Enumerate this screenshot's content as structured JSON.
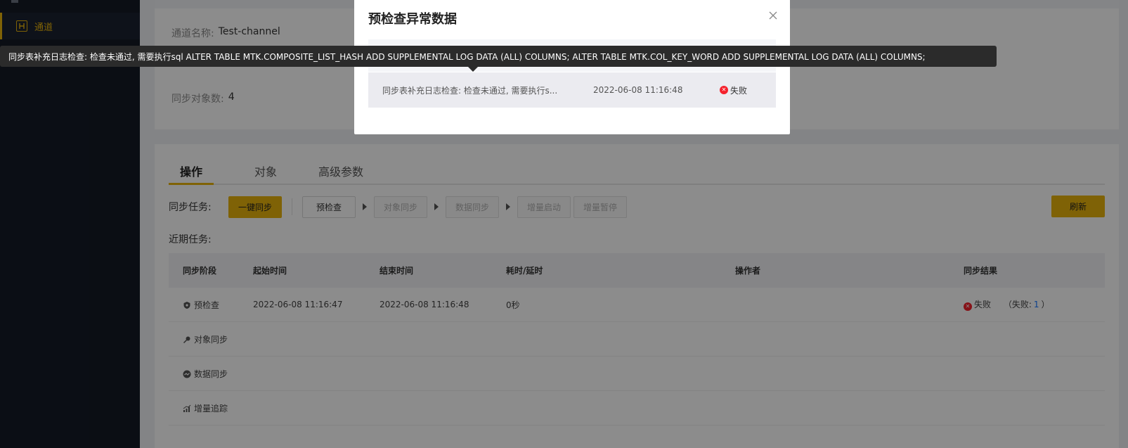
{
  "sidebar": {
    "items": [
      {
        "label": "通道",
        "icon": "channel-icon",
        "active": true
      }
    ],
    "accent": "#e7b30b"
  },
  "info": {
    "channel_name_label": "通道名称:",
    "channel_name_value": "Test-channel",
    "sync_count_label": "同步对象数:",
    "sync_count_value": "4"
  },
  "tabs": [
    {
      "label": "操作",
      "active": true
    },
    {
      "label": "对象",
      "active": false
    },
    {
      "label": "高级参数",
      "active": false
    }
  ],
  "tasks": {
    "label": "同步任务:",
    "one_click": "一键同步",
    "precheck": "预检查",
    "object_sync": "对象同步",
    "data_sync": "数据同步",
    "incr_start": "增量启动",
    "incr_pause": "增量暂停",
    "refresh": "刷新"
  },
  "recent": {
    "label": "近期任务:",
    "headers": [
      "同步阶段",
      "起始时间",
      "结束时间",
      "耗时/延时",
      "操作者",
      "同步结果"
    ],
    "rows": [
      {
        "stage": "预检查",
        "start": "2022-06-08 11:16:47",
        "end": "2022-06-08 11:16:48",
        "duration": "0秒",
        "operator": "",
        "result": "失败",
        "fail_prefix": "（失败:",
        "fail_count": "1",
        "fail_suffix": "）"
      },
      {
        "stage": "对象同步"
      },
      {
        "stage": "数据同步"
      },
      {
        "stage": "增量追踪"
      }
    ]
  },
  "modal": {
    "title": "预检查异常数据",
    "row": {
      "message": "同步表补充日志检查: 检查未通过, 需要执行s...",
      "time": "2022-06-08 11:16:48",
      "status": "失败"
    }
  },
  "tooltip": {
    "text": "同步表补充日志检查: 检查未通过, 需要执行sql ALTER TABLE MTK.COMPOSITE_LIST_HASH ADD SUPPLEMENTAL LOG DATA (ALL) COLUMNS; ALTER TABLE MTK.COL_KEY_WORD ADD SUPPLEMENTAL LOG DATA (ALL) COLUMNS;"
  }
}
